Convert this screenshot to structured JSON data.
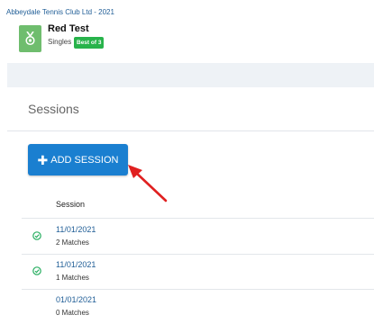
{
  "header": {
    "club": "Abbeydale Tennis Club Ltd - 2021",
    "event_name": "Red Test",
    "event_type": "Singles",
    "format_badge": "Best of 3",
    "logo_icon": "medal-icon",
    "logo_color": "#6fbd6e",
    "badge_color": "#28b34b"
  },
  "sessions": {
    "title": "Sessions",
    "add_button_icon": "plus-icon",
    "add_button_label": "ADD SESSION",
    "add_button_color": "#1a7fd0",
    "column_header": "Session",
    "rows": [
      {
        "date": "11/01/2021",
        "matches": "2 Matches",
        "completed": true
      },
      {
        "date": "11/01/2021",
        "matches": "1 Matches",
        "completed": true
      },
      {
        "date": "01/01/2021",
        "matches": "0 Matches",
        "completed": false
      }
    ]
  },
  "annotation": {
    "arrow_color": "#e02020"
  }
}
